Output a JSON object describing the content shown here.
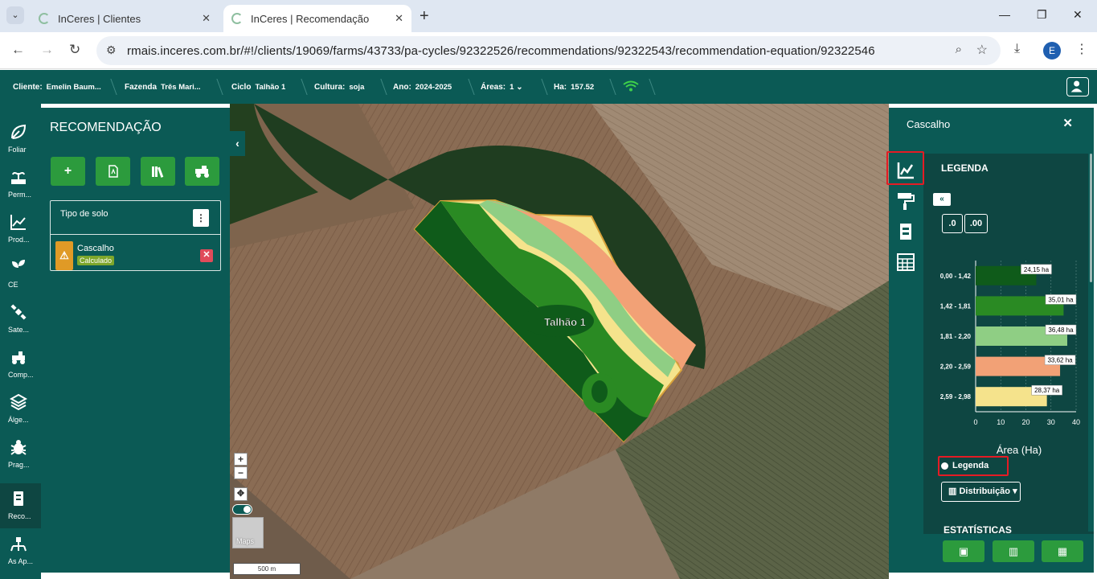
{
  "browser": {
    "tabs": [
      {
        "title": "InCeres | Clientes"
      },
      {
        "title": "InCeres | Recomendação"
      }
    ],
    "url": "rmais.inceres.com.br/#!/clients/19069/farms/43733/pa-cycles/92322526/recommendations/92322543/recommendation-equation/92322546",
    "profile_initial": "E"
  },
  "header": {
    "cliente_label": "Cliente:",
    "cliente_value": "Emelin Baum...",
    "fazenda_label": "Fazenda",
    "fazenda_value": "Três Mari...",
    "ciclo_label": "Ciclo",
    "ciclo_value": "Talhão 1",
    "cultura_label": "Cultura:",
    "cultura_value": "soja",
    "ano_label": "Ano:",
    "ano_value": "2024-2025",
    "areas_label": "Áreas:",
    "areas_value": "1",
    "ha_label": "Ha:",
    "ha_value": "157.52"
  },
  "rail": [
    {
      "label": "Foliar",
      "icon": "leaf-icon"
    },
    {
      "label": "Perm...",
      "icon": "plant-icon"
    },
    {
      "label": "Prod...",
      "icon": "chart-icon"
    },
    {
      "label": "CE",
      "icon": "sprout-icon"
    },
    {
      "label": "Sate...",
      "icon": "satellite-icon"
    },
    {
      "label": "Comp...",
      "icon": "tractor-icon"
    },
    {
      "label": "Álge...",
      "icon": "layers-icon"
    },
    {
      "label": "Prag...",
      "icon": "bug-icon"
    },
    {
      "label": "Reco...",
      "icon": "document-icon"
    },
    {
      "label": "As Ap...",
      "icon": "sprayer-icon"
    }
  ],
  "left_panel": {
    "title": "RECOMENDAÇÃO",
    "soil_header": "Tipo de solo",
    "soil_name": "Cascalho",
    "soil_status": "Calculado"
  },
  "map": {
    "field_label": "Talhão 1",
    "zoom_in": "+",
    "zoom_out": "−",
    "maps_label": "Maps",
    "scale_label": "500 m",
    "zone_colors": [
      "#0f5b1a",
      "#2a8a23",
      "#8fce84",
      "#f2a176",
      "#f5e38c"
    ]
  },
  "right_panel": {
    "title": "Cascalho",
    "legend_title": "LEGENDA",
    "dec_minus": ".0",
    "dec_plus": ".00",
    "legend_radio": "Legenda",
    "distribution_button": "Distribuição",
    "stats_title": "ESTATÍSTICAS"
  },
  "chart_data": {
    "type": "bar",
    "orientation": "horizontal",
    "categories": [
      "0,00 - 1,42",
      "1,42 - 1,81",
      "1,81 - 2,20",
      "2,20 - 2,59",
      "2,59 - 2,98"
    ],
    "values": [
      24.15,
      35.01,
      36.48,
      33.62,
      28.37
    ],
    "data_labels": [
      "24,15 ha",
      "35,01 ha",
      "36,48 ha",
      "33,62 ha",
      "28,37 ha"
    ],
    "colors": [
      "#0f5b1a",
      "#2a8a23",
      "#8fce84",
      "#f2a176",
      "#f5e38c"
    ],
    "xlabel": "Área (Ha)",
    "xticks": [
      "0",
      "10",
      "20",
      "30",
      "40"
    ],
    "xlim": [
      0,
      40
    ]
  }
}
